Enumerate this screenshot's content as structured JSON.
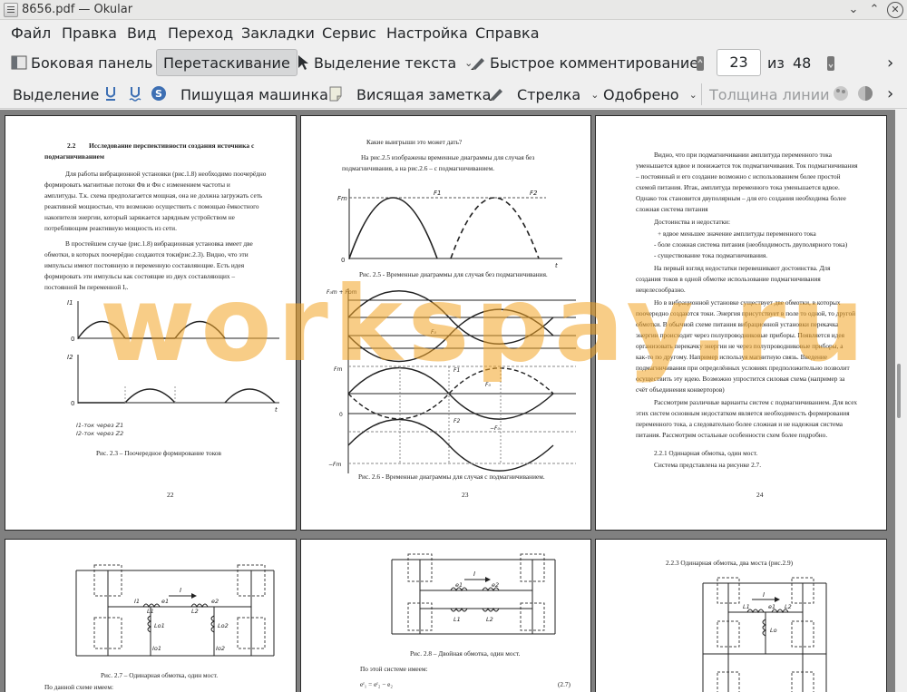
{
  "window": {
    "title": "8656.pdf — Okular",
    "buttons": {
      "minimize": "⌄",
      "maximize": "⌃",
      "close": "✕"
    }
  },
  "menu": [
    "Файл",
    "Правка",
    "Вид",
    "Переход",
    "Закладки",
    "Сервис",
    "Настройка",
    "Справка"
  ],
  "toolbar": {
    "sidebar": "Боковая панель",
    "drag": "Перетаскивание",
    "text_select": "Выделение текста",
    "quick_annot": "Быстрое комментирование",
    "page_current": "23",
    "page_of": "из",
    "page_total": "48",
    "more": "›"
  },
  "annot_toolbar": {
    "highlight": "Выделение",
    "typewriter": "Пишущая машинка",
    "popup_note": "Висящая заметка",
    "arrow": "Стрелка",
    "approved": "Одобрено",
    "line_width": "Толщина линии",
    "more": "›"
  },
  "watermark": "workspay.ru",
  "pages": {
    "p22": {
      "heading_num": "2.2",
      "heading": "Исследование перспективности создания источника с",
      "heading2": "подмагничиванием",
      "lines": [
        "Для работы вибрационной установки (рис.1.8) необходимо поочерёдно",
        "формировать магнитные потоки Фв и Фн с изменением частоты и",
        "амплитуды. Т.к. схема предполагается мощная, она не должна загружать сеть",
        "реактивной мощностью, что возможно осуществить с помощью ёмкостного",
        "накопителя энергии, который заряжается зарядным устройством не",
        "потребляющим реактивную мощность из сети.",
        "В простейшем случае (рис.1.8) вибрационная установка имеет две",
        "обмотки, в которых поочерёдно создаются токи(рис.2.3). Видно, что эти",
        "импульсы имеют постоянную и переменную составляющие. Есть идея",
        "формировать эти импульсы как состоящие из двух составляющих –",
        "постоянной Iм переменной Iᵥ."
      ],
      "plot_labels": {
        "i1": "I1",
        "i2": "I2",
        "zero": "0",
        "t": "t",
        "legend1": "I1-ток через Z1",
        "legend2": "I2-ток через Z2"
      },
      "caption": "Рис. 2.3 – Поочередное формирование токов",
      "num": "22"
    },
    "p23": {
      "q": "Какие выигрыши это может дать?",
      "lines": [
        "На рис.2.5 изображены временные диаграммы для случая без",
        "подмагничивания, а на рис.2.6 – с подмагничиванием."
      ],
      "plot1_labels": {
        "fm": "Fm",
        "f1": "F1",
        "f2": "F2",
        "zero": "0",
        "t": "t"
      },
      "caption1": "Рис. 2.5 - Временные диаграммы для случая без подмагничивания.",
      "plot2_labels": {
        "fmfom": "F₀m + Fom",
        "fo": "F₀",
        "fm": "Fm",
        "f1": "F1",
        "fo2": "F₀",
        "f2": "F2",
        "mfo": "−F₀",
        "mfm": "−Fm",
        "zero": "0"
      },
      "caption2": "Рис. 2.6 - Временные диаграммы для случая с подмагничиванием.",
      "num": "23"
    },
    "p24": {
      "lines": [
        "Видно, что при подмагничивании амплитуда переменного тока",
        "уменьшается вдвое и понижается ток подмагничивания. Ток подмагничивания",
        "– постоянный и его создание возможно с использованием более простой",
        "схемой питания. Итак, амплитуда переменного тока уменьшается вдвое.",
        "Однако ток становится двуполярным – для его создания необходима более",
        "сложная система питания"
      ],
      "pros_title": "Достоинства и недостатки:",
      "pros": [
        "+ вдвое меньшее значение амплитуды переменного тока",
        "- боле сложная система питания (необходимость двуполярного тока)",
        "- существование тока подмагничивания."
      ],
      "lines2": [
        "На первый взгляд недостатки перевешивают достоинства. Для",
        "создания токов в одной обмотке использование подмагничивания",
        "нецелесообразно.",
        "Но в вибрационной установке существует две обмотки, в которых",
        "поочередно создаются токи. Энергия присутствует в поле то одной, то другой",
        "обмотки. В обычной схеме питания вибрационной установки перекачка",
        "энергии происходит через полупроводниковые приборы. Появляется идея",
        "организовать перекачку энергии не через полупроводниковые приборы, а",
        "как-то по другому. Например используя магнитную связь. Введение",
        "подмагничивания при определённых условиях предположительно позволит",
        "осуществить эту идею. Возможно упростится силовая схема (например за",
        "счёт объединения конверторов)",
        "Рассмотрим различные варианты систем с подмагничиванием. Для всех",
        "этих систем основным недостатком является необходимость формирования",
        "переменного тока, а следовательно более сложная и не надежная система",
        "питания. Рассмотрим остальные особенности схем более подробно."
      ],
      "sub1": "2.2.1 Одинарная обмотка, один мост.",
      "sub2": "Система представлена на рисунке 2.7.",
      "num": "24"
    },
    "p25": {
      "caption": "Рис. 2.7 – Одинарная обмотка, один мост.",
      "tail": "По данной схеме имеем:",
      "labels": {
        "i": "I",
        "i1": "I1",
        "e1": "e1",
        "l1": "L1",
        "l2": "L2",
        "e2": "e2",
        "lo1": "Lo1",
        "lo2": "Lo2",
        "io1": "Io1",
        "io2": "Io2"
      }
    },
    "p26": {
      "caption": "Рис. 2.8 – Двойная обмотка, один мост.",
      "tail": "По этой системе имеем:",
      "eq_num": "(2.7)",
      "eq": "eᶠ₁ = eᶠ₂ − e₂",
      "labels": {
        "i": "I",
        "e1": "e1",
        "e2": "e2",
        "l1": "L1",
        "l2": "L2"
      }
    },
    "p27": {
      "heading": "2.2.3   Одинарная обмотка, два моста (рис.2.9)",
      "labels": {
        "i": "I",
        "e1": "e1",
        "l1": "L1",
        "l2": "L2",
        "lo": "Lo"
      }
    }
  }
}
